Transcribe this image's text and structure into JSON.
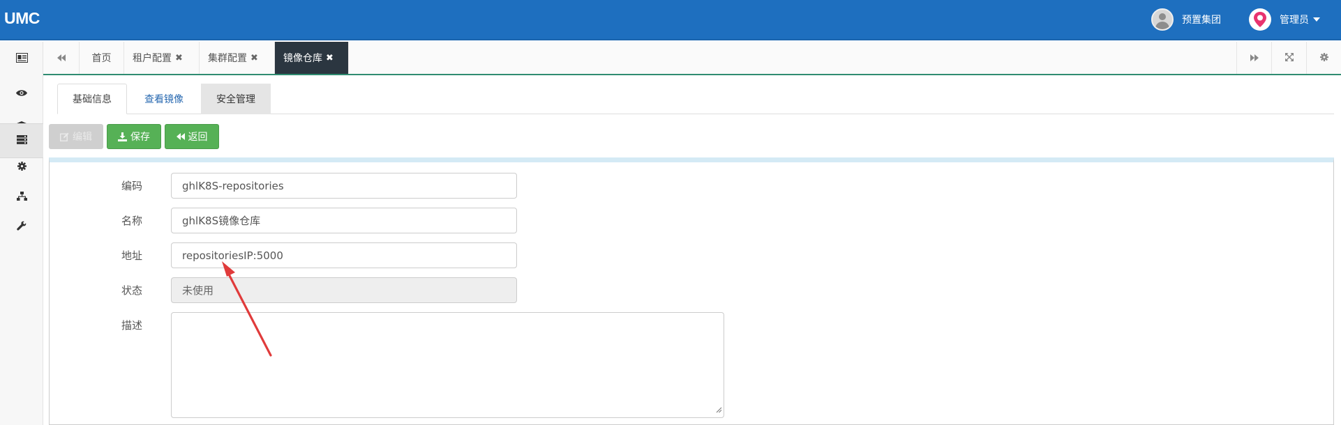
{
  "app": {
    "logo": "UMC"
  },
  "header": {
    "group_name": "预置集团",
    "user_name": "管理员"
  },
  "sidebar": {
    "items": [
      {
        "icon": "id-card-icon"
      },
      {
        "icon": "eye-icon"
      },
      {
        "icon": "bank-icon"
      },
      {
        "icon": "server-icon",
        "active": true
      },
      {
        "icon": "gear-icon"
      },
      {
        "icon": "sitemap-icon"
      },
      {
        "icon": "wrench-icon"
      }
    ]
  },
  "tabbar": {
    "tabs": [
      {
        "label": "首页",
        "closable": false
      },
      {
        "label": "租户配置",
        "closable": true
      },
      {
        "label": "集群配置",
        "closable": true
      },
      {
        "label": "镜像仓库",
        "closable": true,
        "active": true
      }
    ],
    "close_glyph": "✖"
  },
  "content_tabs": [
    {
      "label": "基础信息",
      "active": true
    },
    {
      "label": "查看镜像"
    },
    {
      "label": "安全管理"
    }
  ],
  "actions": {
    "edit": "编辑",
    "save": "保存",
    "back": "返回"
  },
  "form": {
    "code_label": "编码",
    "code_value": "ghlK8S-repositories",
    "name_label": "名称",
    "name_value": "ghlK8S镜像仓库",
    "address_label": "地址",
    "address_value": "repositoriesIP:5000",
    "status_label": "状态",
    "status_value": "未使用",
    "desc_label": "描述",
    "desc_value": ""
  },
  "colors": {
    "topbar": "#1e6fbf",
    "active_tab": "#2b3640",
    "accent_line": "#2f8c71",
    "button_green": "#56b156",
    "annotation_arrow": "#e03b3b"
  }
}
